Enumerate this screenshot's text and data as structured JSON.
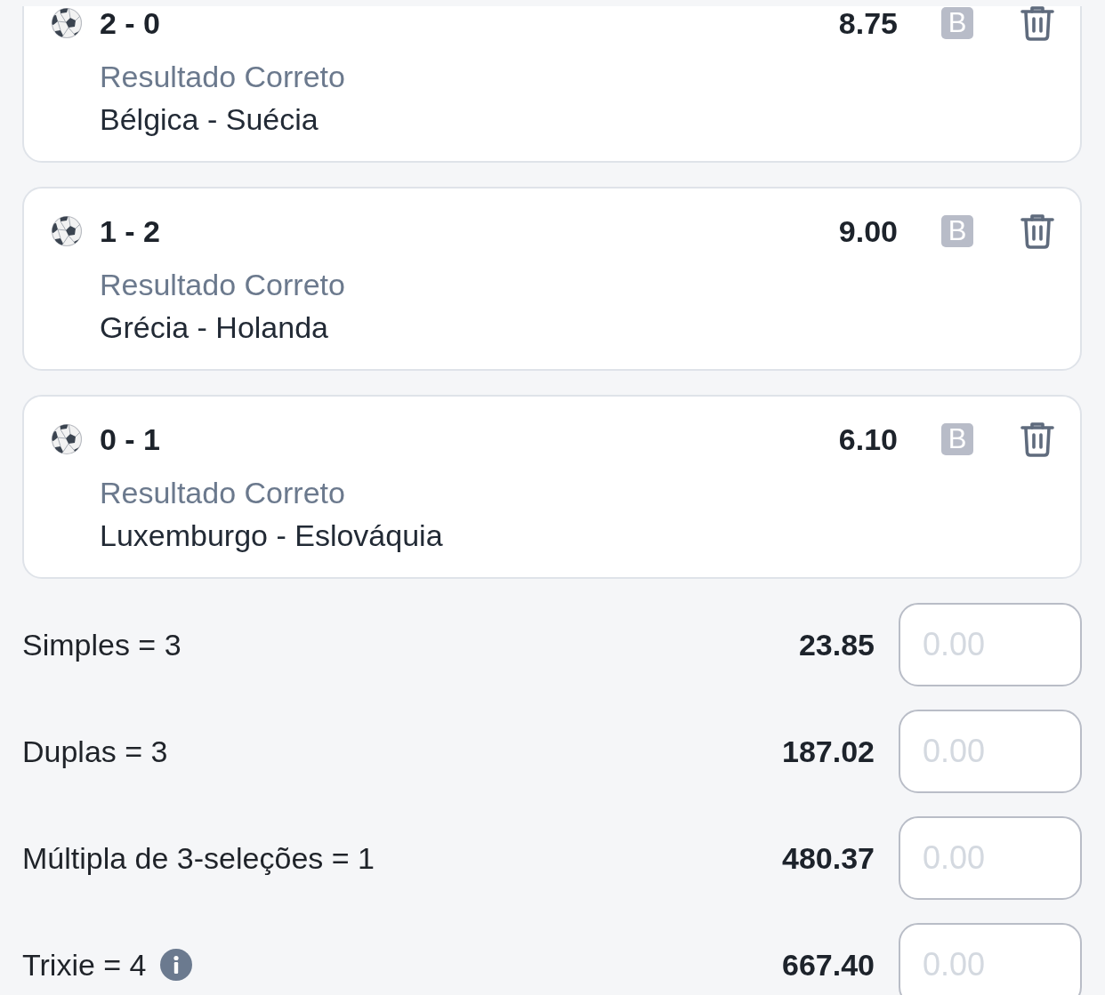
{
  "selections": [
    {
      "score": "2 - 0",
      "odds": "8.75",
      "badge": "B",
      "market": "Resultado Correto",
      "match": "Bélgica - Suécia"
    },
    {
      "score": "1 - 2",
      "odds": "9.00",
      "badge": "B",
      "market": "Resultado Correto",
      "match": "Grécia - Holanda"
    },
    {
      "score": "0 - 1",
      "odds": "6.10",
      "badge": "B",
      "market": "Resultado Correto",
      "match": "Luxemburgo - Eslováquia"
    }
  ],
  "bet_types": [
    {
      "label": "Simples = 3",
      "info": false,
      "potential": "23.85",
      "stake": {
        "placeholder": "0.00"
      }
    },
    {
      "label": "Duplas = 3",
      "info": false,
      "potential": "187.02",
      "stake": {
        "placeholder": "0.00"
      }
    },
    {
      "label": "Múltipla de 3-seleções = 1",
      "info": false,
      "potential": "480.37",
      "stake": {
        "placeholder": "0.00"
      }
    },
    {
      "label": "Trixie = 4",
      "info": true,
      "potential": "667.40",
      "stake": {
        "placeholder": "0.00"
      }
    }
  ]
}
